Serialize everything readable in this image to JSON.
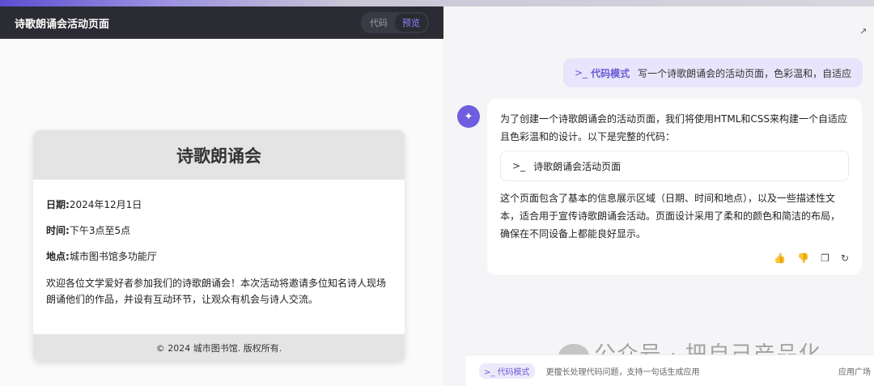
{
  "preview": {
    "title": "诗歌朗诵会活动页面",
    "toggle_code": "代码",
    "toggle_preview": "预览"
  },
  "card": {
    "heading": "诗歌朗诵会",
    "date_label": "日期:",
    "date_value": "2024年12月1日",
    "time_label": "时间:",
    "time_value": "下午3点至5点",
    "place_label": "地点:",
    "place_value": "城市图书馆多功能厅",
    "description": "欢迎各位文学爱好者参加我们的诗歌朗诵会！本次活动将邀请多位知名诗人现场朗诵他们的作品，并设有互动环节，让观众有机会与诗人交流。",
    "footer": "© 2024 城市图书馆. 版权所有."
  },
  "chat": {
    "user_mode": "代码模式",
    "user_prompt": "写一个诗歌朗诵会的活动页面，色彩温和，自适应",
    "reply_intro": "为了创建一个诗歌朗诵会的活动页面，我们将使用HTML和CSS来构建一个自适应且色彩温和的设计。以下是完整的代码：",
    "code_block_title": "诗歌朗诵会活动页面",
    "reply_outro": "这个页面包含了基本的信息展示区域（日期、时间和地点），以及一些描述性文本，适合用于宣传诗歌朗诵会活动。页面设计采用了柔和的颜色和简洁的布局，确保在不同设备上都能良好显示。",
    "actions": [
      "thumbs-up-icon",
      "thumbs-down-icon",
      "copy-icon",
      "refresh-icon"
    ]
  },
  "watermark": "公众号 · 把自己产品化",
  "input": {
    "mode_chip": "代码模式",
    "placeholder": "更擅长处理代码问题，支持一句话生成应用",
    "right_text": "应用广场"
  },
  "colors": {
    "accent": "#6b5bd6",
    "header_bg": "#2b2b33"
  }
}
